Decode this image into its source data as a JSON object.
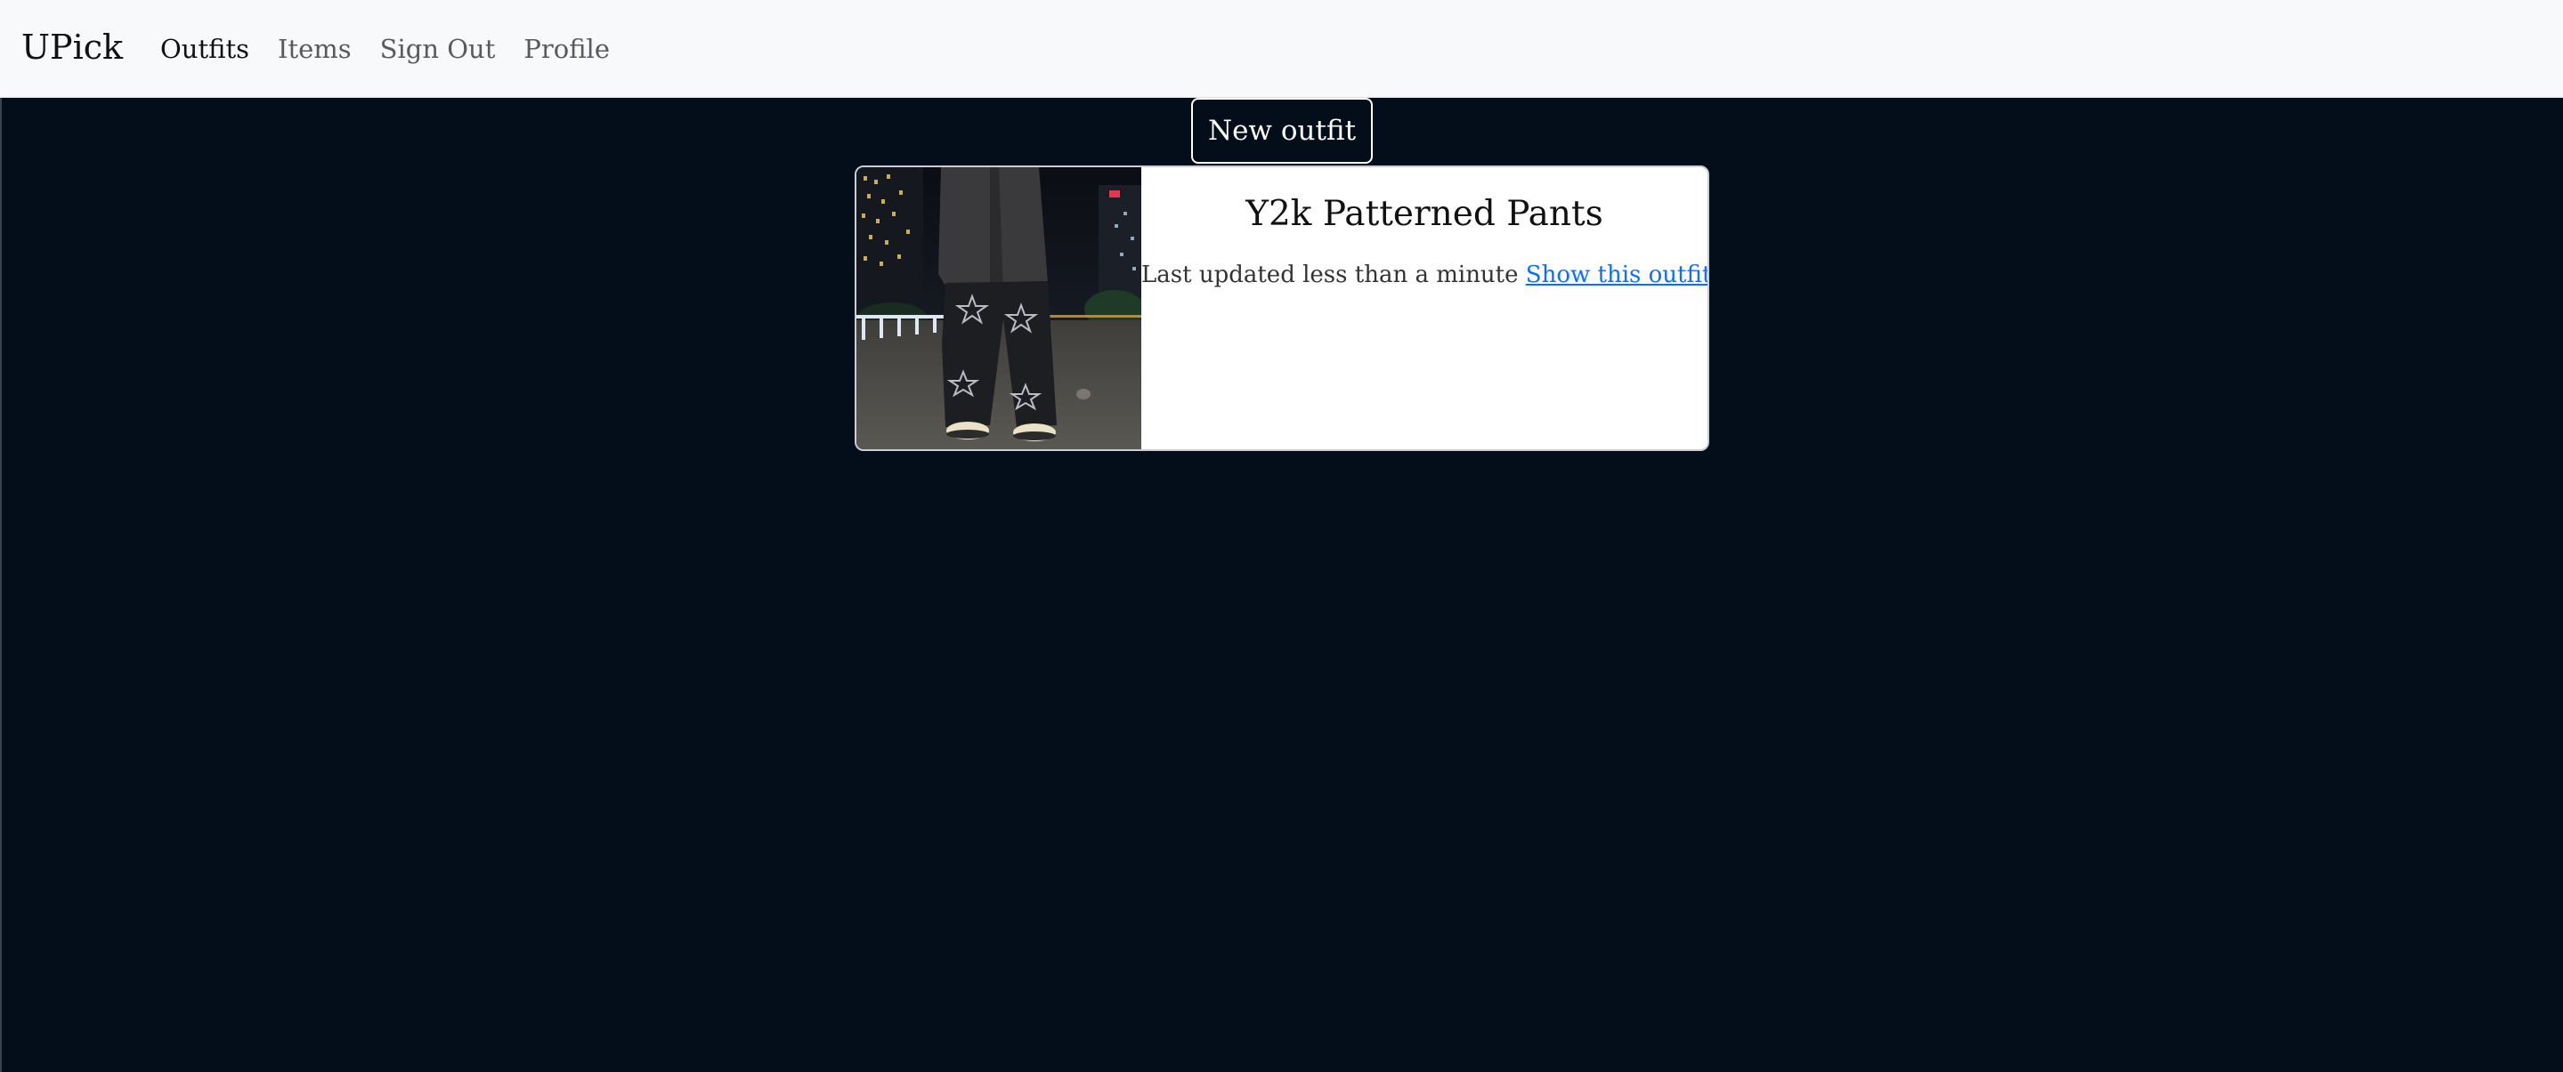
{
  "navbar": {
    "brand": "UPick",
    "links": [
      {
        "label": "Outfits",
        "active": true
      },
      {
        "label": "Items",
        "active": false
      },
      {
        "label": "Sign Out",
        "active": false
      },
      {
        "label": "Profile",
        "active": false
      }
    ]
  },
  "main": {
    "new_outfit_label": "New outfit",
    "outfits": [
      {
        "title": "Y2k Patterned Pants",
        "updated_text": "Last updated less than a minute",
        "link_label": "Show this outfit",
        "image_alt": "outfit-photo"
      }
    ]
  },
  "colors": {
    "page_background": "#030e1a",
    "navbar_background": "#f8f9fa",
    "link": "#0d6efd"
  }
}
